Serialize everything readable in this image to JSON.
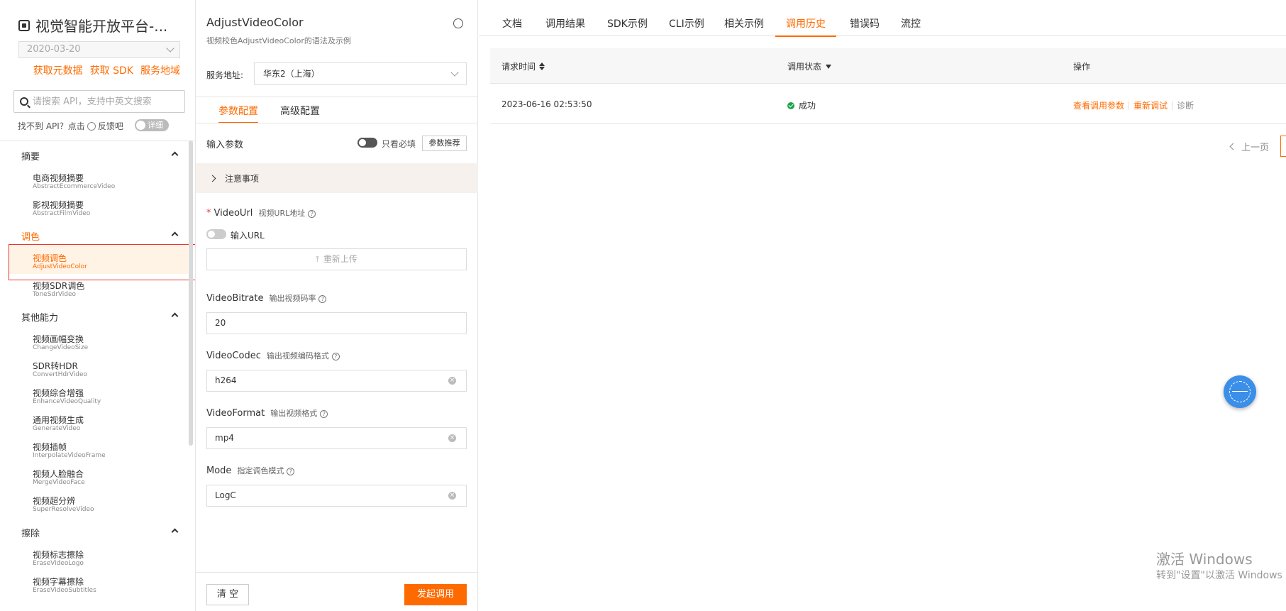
{
  "sidebar": {
    "title": "视觉智能开放平台-...",
    "date": "2020-03-20",
    "links": [
      "获取元数据",
      "获取 SDK",
      "服务地域"
    ],
    "search_placeholder": "请搜索 API，支持中英文搜索",
    "help_text_1": "找不到 API？点击",
    "help_text_2": "反馈吧",
    "detail_toggle": "详细",
    "groups": [
      {
        "label": "摘要",
        "items": [
          {
            "zh": "电商视频摘要",
            "en": "AbstractEcommerceVideo"
          },
          {
            "zh": "影视视频摘要",
            "en": "AbstractFilmVideo"
          }
        ]
      },
      {
        "label": "调色",
        "items": [
          {
            "zh": "视频调色",
            "en": "AdjustVideoColor"
          },
          {
            "zh": "视频SDR调色",
            "en": "ToneSdrVideo"
          }
        ]
      },
      {
        "label": "其他能力",
        "items": [
          {
            "zh": "视频画幅变换",
            "en": "ChangeVideoSize"
          },
          {
            "zh": "SDR转HDR",
            "en": "ConvertHdrVideo"
          },
          {
            "zh": "视频综合增强",
            "en": "EnhanceVideoQuality"
          },
          {
            "zh": "通用视频生成",
            "en": "GenerateVideo"
          },
          {
            "zh": "视频插帧",
            "en": "InterpolateVideoFrame"
          },
          {
            "zh": "视频人脸融合",
            "en": "MergeVideoFace"
          },
          {
            "zh": "视频超分辨",
            "en": "SuperResolveVideo"
          }
        ]
      },
      {
        "label": "擦除",
        "items": [
          {
            "zh": "视频标志擦除",
            "en": "EraseVideoLogo"
          },
          {
            "zh": "视频字幕擦除",
            "en": "EraseVideoSubtitles"
          }
        ]
      }
    ]
  },
  "config": {
    "title": "AdjustVideoColor",
    "subtitle": "视频校色AdjustVideoColor的语法及示例",
    "address_label": "服务地址:",
    "address_value": "华东2（上海）",
    "tabs": [
      "参数配置",
      "高级配置"
    ],
    "input_params_label": "输入参数",
    "only_required_label": "只看必填",
    "recommend_button": "参数推荐",
    "notice_label": "注意事项",
    "fields": [
      {
        "name": "VideoUrl",
        "desc": "视频URL地址",
        "required": "*"
      },
      {
        "name": "VideoBitrate",
        "desc": "输出视频码率",
        "value": "20"
      },
      {
        "name": "VideoCodec",
        "desc": "输出视频编码格式",
        "value": "h264"
      },
      {
        "name": "VideoFormat",
        "desc": "输出视频格式",
        "value": "mp4"
      },
      {
        "name": "Mode",
        "desc": "指定调色模式",
        "value": "LogC"
      }
    ],
    "url_input_label": "输入URL",
    "upload_label": "重新上传",
    "clear_button": "清 空",
    "submit_button": "发起调用"
  },
  "right": {
    "tabs": [
      "文档",
      "调用结果",
      "SDK示例",
      "CLI示例",
      "相关示例",
      "调用历史",
      "错误码",
      "流控"
    ],
    "active_tab": "调用历史",
    "table": {
      "headers": [
        "请求时间",
        "调用状态",
        "操作"
      ],
      "rows": [
        {
          "time": "2023-06-16 02:53:50",
          "status": "成功",
          "actions": [
            "查看调用参数",
            "重新调试",
            "诊断"
          ]
        }
      ]
    },
    "pager_prev": "上一页",
    "watermark_1": "激活 Windows",
    "watermark_2": "转到\"设置\"以激活 Windows"
  },
  "colors": {
    "accent": "#ff6a00",
    "success": "#1ba548"
  }
}
